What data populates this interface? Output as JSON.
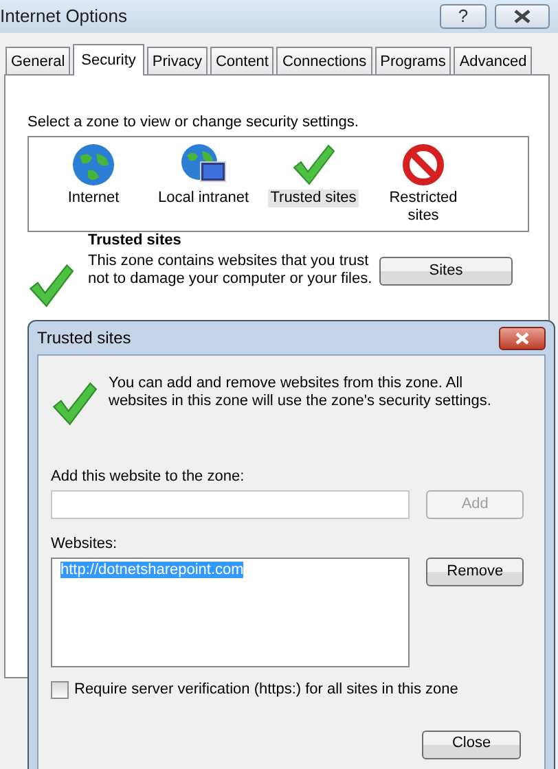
{
  "window": {
    "title": "Internet Options",
    "help_button": "?"
  },
  "tabs": [
    {
      "label": "General",
      "selected": false
    },
    {
      "label": "Security",
      "selected": true
    },
    {
      "label": "Privacy",
      "selected": false
    },
    {
      "label": "Content",
      "selected": false
    },
    {
      "label": "Connections",
      "selected": false
    },
    {
      "label": "Programs",
      "selected": false
    },
    {
      "label": "Advanced",
      "selected": false
    }
  ],
  "zone_prompt": "Select a zone to view or change security settings.",
  "zones": [
    {
      "label": "Internet",
      "kind": "internet",
      "selected": false
    },
    {
      "label": "Local intranet",
      "kind": "intranet",
      "selected": false
    },
    {
      "label": "Trusted sites",
      "kind": "trusted",
      "selected": true
    },
    {
      "label": "Restricted sites",
      "kind": "restricted",
      "selected": false
    }
  ],
  "zone_info": {
    "title": "Trusted sites",
    "description": "This zone contains websites that you trust not to damage your computer or your files.",
    "button": "Sites"
  },
  "dialog": {
    "title": "Trusted sites",
    "message": "You can add and remove websites from this zone. All websites in this zone will use the zone's security settings.",
    "add_label": "Add this website to the zone:",
    "add_button": {
      "label": "Add",
      "disabled": true
    },
    "websites_label": "Websites:",
    "websites": [
      {
        "url": "http://dotnetsharepoint.com",
        "selected": true
      }
    ],
    "remove_button": "Remove",
    "require_https": {
      "label": "Require server verification (https:) for all sites in this zone",
      "checked": false
    },
    "close_button": "Close"
  }
}
